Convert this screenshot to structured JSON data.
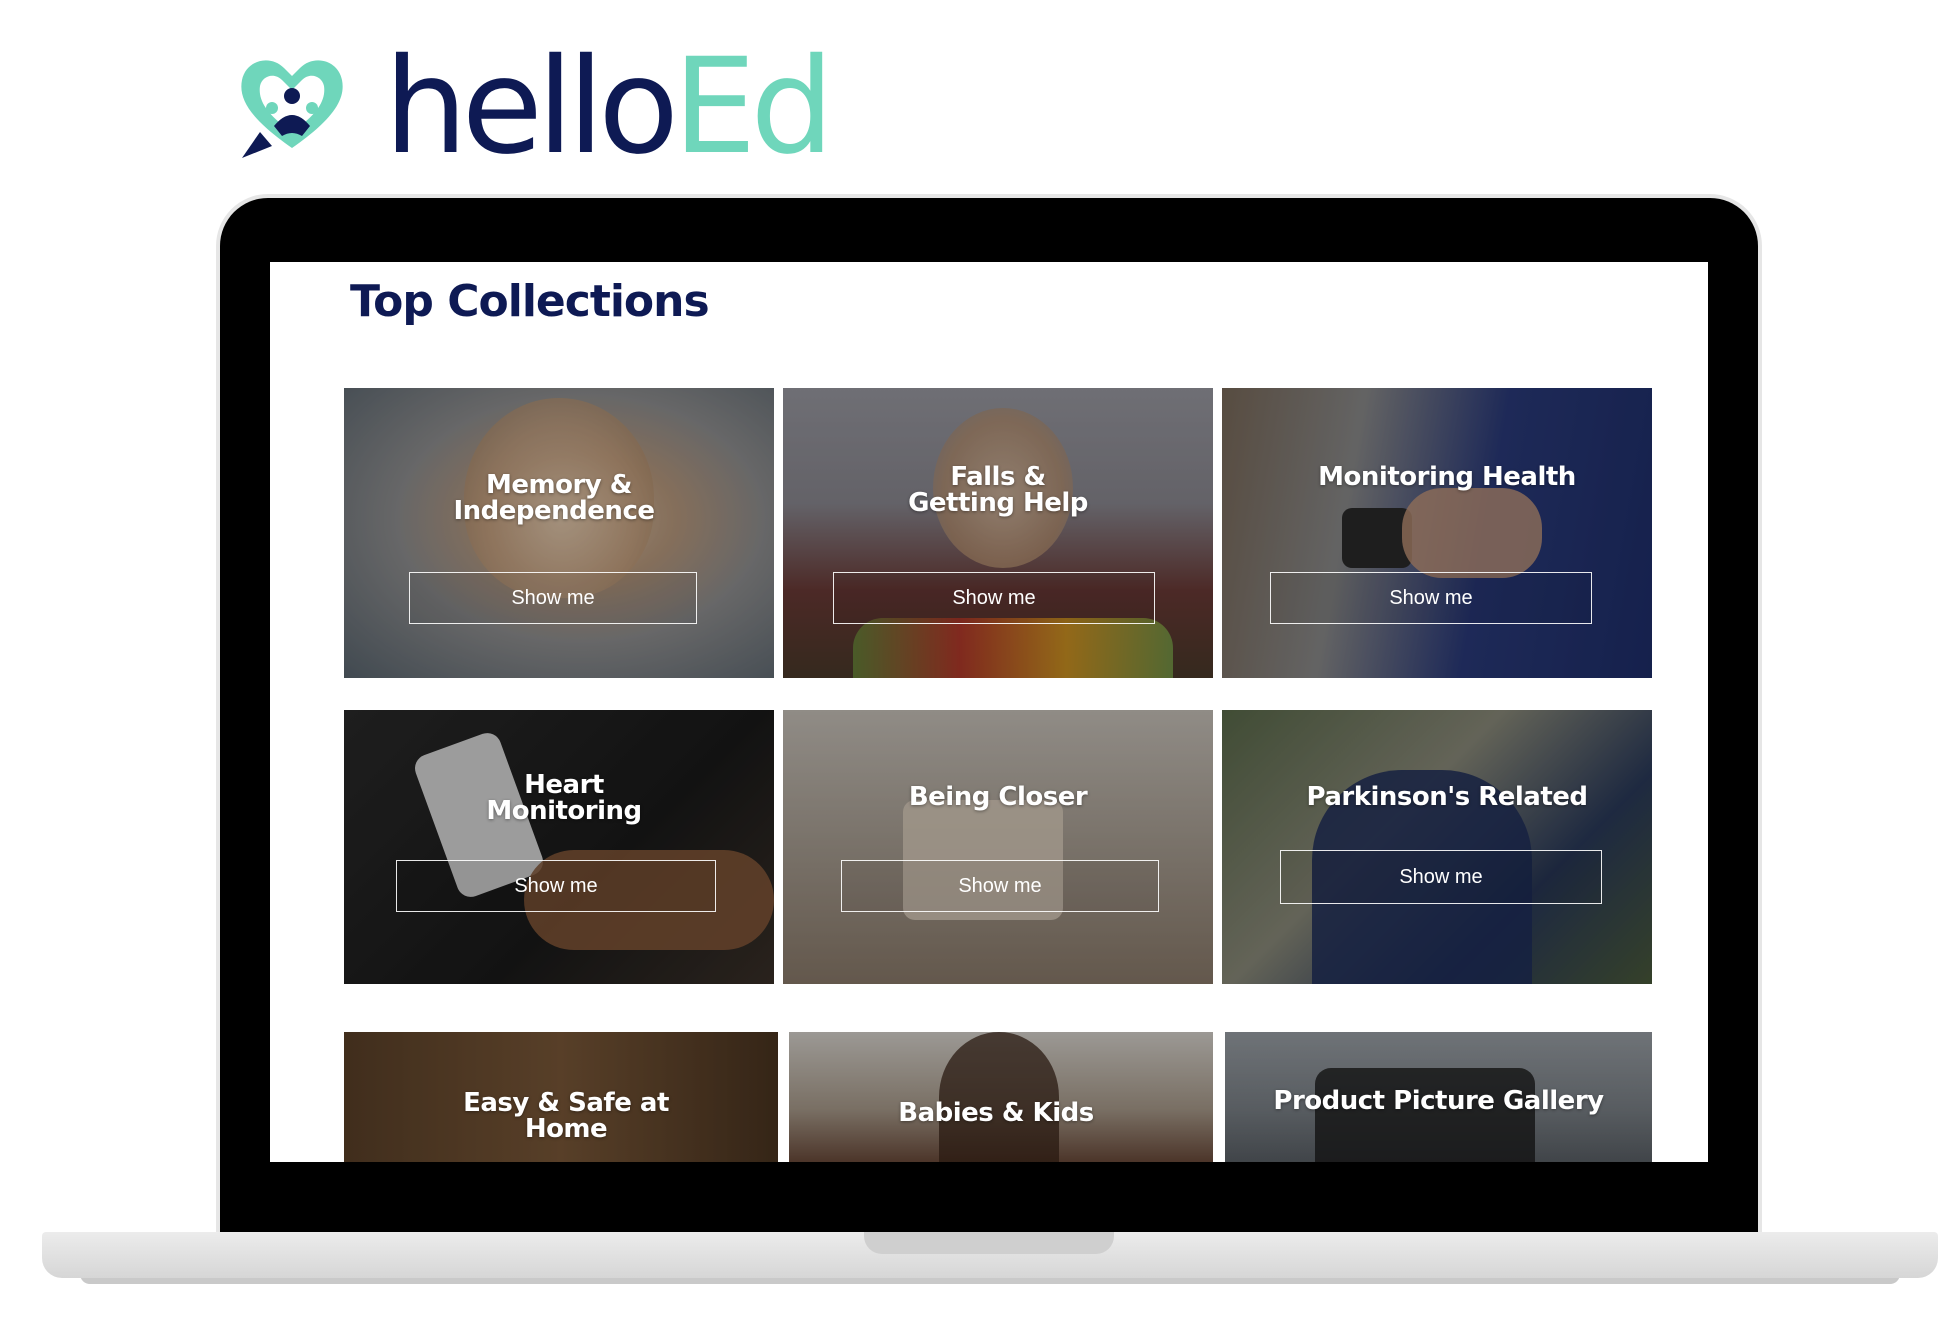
{
  "brand": {
    "logo_text_primary": "hello",
    "logo_text_accent": "Ed",
    "colors": {
      "navy": "#0e1a54",
      "mint": "#6fd6bb"
    }
  },
  "page": {
    "title": "Top Collections"
  },
  "collections": [
    {
      "title_line1": "Memory &",
      "title_line2": "Independence",
      "button": "Show me"
    },
    {
      "title_line1": "Falls &",
      "title_line2": "Getting Help",
      "button": "Show me"
    },
    {
      "title_line1": "Monitoring Health",
      "title_line2": "",
      "button": "Show me"
    },
    {
      "title_line1": "Heart",
      "title_line2": "Monitoring",
      "button": "Show me"
    },
    {
      "title_line1": "Being Closer",
      "title_line2": "",
      "button": "Show me"
    },
    {
      "title_line1": "Parkinson's Related",
      "title_line2": "",
      "button": "Show me"
    },
    {
      "title_line1": "Easy & Safe at",
      "title_line2": "Home",
      "button": ""
    },
    {
      "title_line1": "Babies & Kids",
      "title_line2": "",
      "button": ""
    },
    {
      "title_line1": "Product Picture Gallery",
      "title_line2": "",
      "button": ""
    }
  ]
}
